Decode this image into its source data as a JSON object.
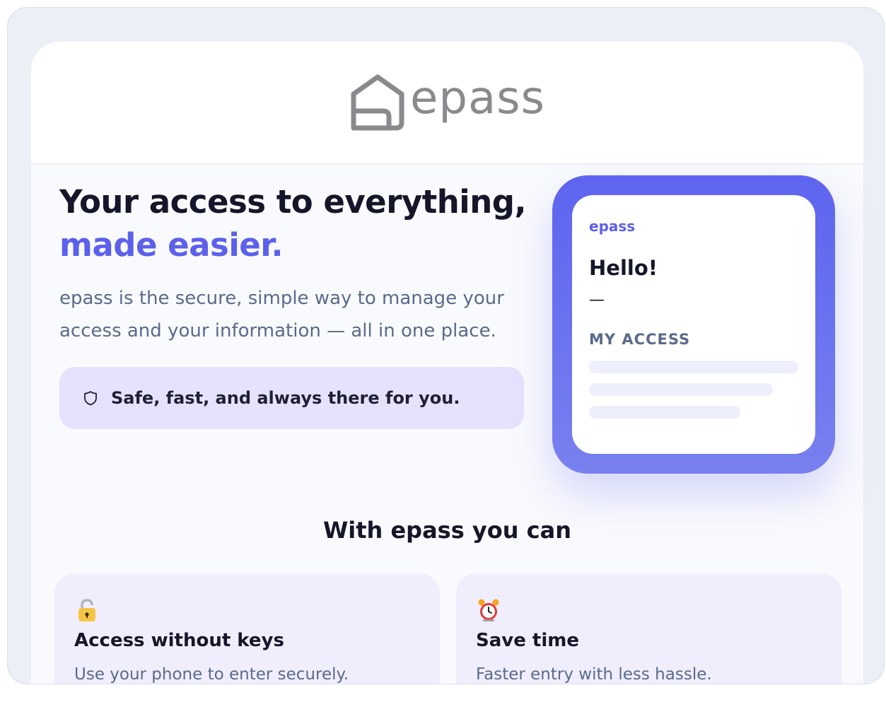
{
  "brand": {
    "logo_text": "epass"
  },
  "hero": {
    "title_line1": "Your access to everything,",
    "title_line2": "made easier.",
    "subtitle": "epass is the secure, simple way to manage your access and your information — all in one place.",
    "badge_icon": "shield-icon",
    "badge_text": "Safe, fast, and always there for you."
  },
  "phone": {
    "brand": "epass",
    "greeting": "Hello!",
    "dash": "—",
    "section_label": "MY ACCESS",
    "placeholder_rows": 3
  },
  "features": {
    "heading": "With epass you can",
    "items": [
      {
        "icon": "padlock-icon",
        "title": "Access without keys",
        "description": "Use your phone to enter securely."
      },
      {
        "icon": "alarm-clock-icon",
        "title": "Save time",
        "description": "Faster entry with less hassle."
      }
    ]
  },
  "colors": {
    "accent": "#5c60ea",
    "heading": "#151629",
    "body_text": "#5a6a8c",
    "pill_bg": "#e6e2fd",
    "feature_bg": "#f0eefd",
    "logo_gray": "#8a8a8e"
  }
}
